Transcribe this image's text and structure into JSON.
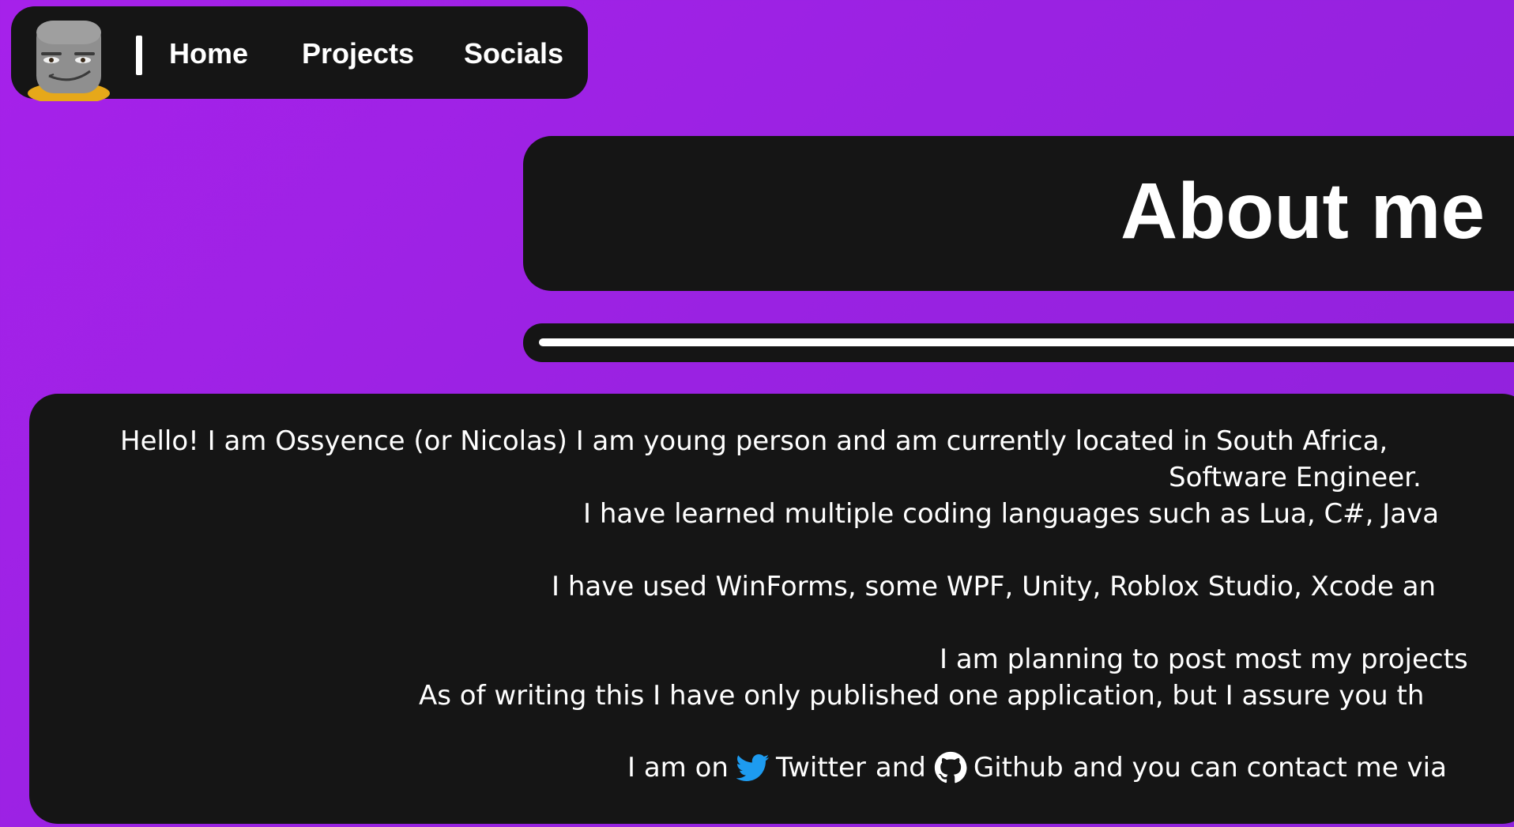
{
  "nav": {
    "avatar_alt": "avatar",
    "links": [
      {
        "label": "Home"
      },
      {
        "label": "Projects"
      },
      {
        "label": "Socials"
      }
    ]
  },
  "page": {
    "title": "About me"
  },
  "about": {
    "line1": "Hello! I am Ossyence (or Nicolas) I am young person and am currently located in South Africa,",
    "line2": "Software Engineer.",
    "line3": "I have learned multiple coding languages such as Lua, C#, Java",
    "line4": "I have used WinForms, some WPF, Unity, Roblox Studio, Xcode an",
    "line5": "I am planning to post most my projects",
    "line6": "As of writing this I have only published one application, but I assure you th",
    "line7_prefix": "I am on",
    "twitter_label": "Twitter",
    "and_word": "and",
    "github_label": "Github",
    "line7_suffix": "and you can contact me via"
  },
  "colors": {
    "background": "#a020f0",
    "panel": "#151515",
    "text": "#ffffff",
    "twitter": "#1d9bf0"
  },
  "icons": [
    "roblox-avatar-icon",
    "twitter-icon",
    "github-icon"
  ]
}
